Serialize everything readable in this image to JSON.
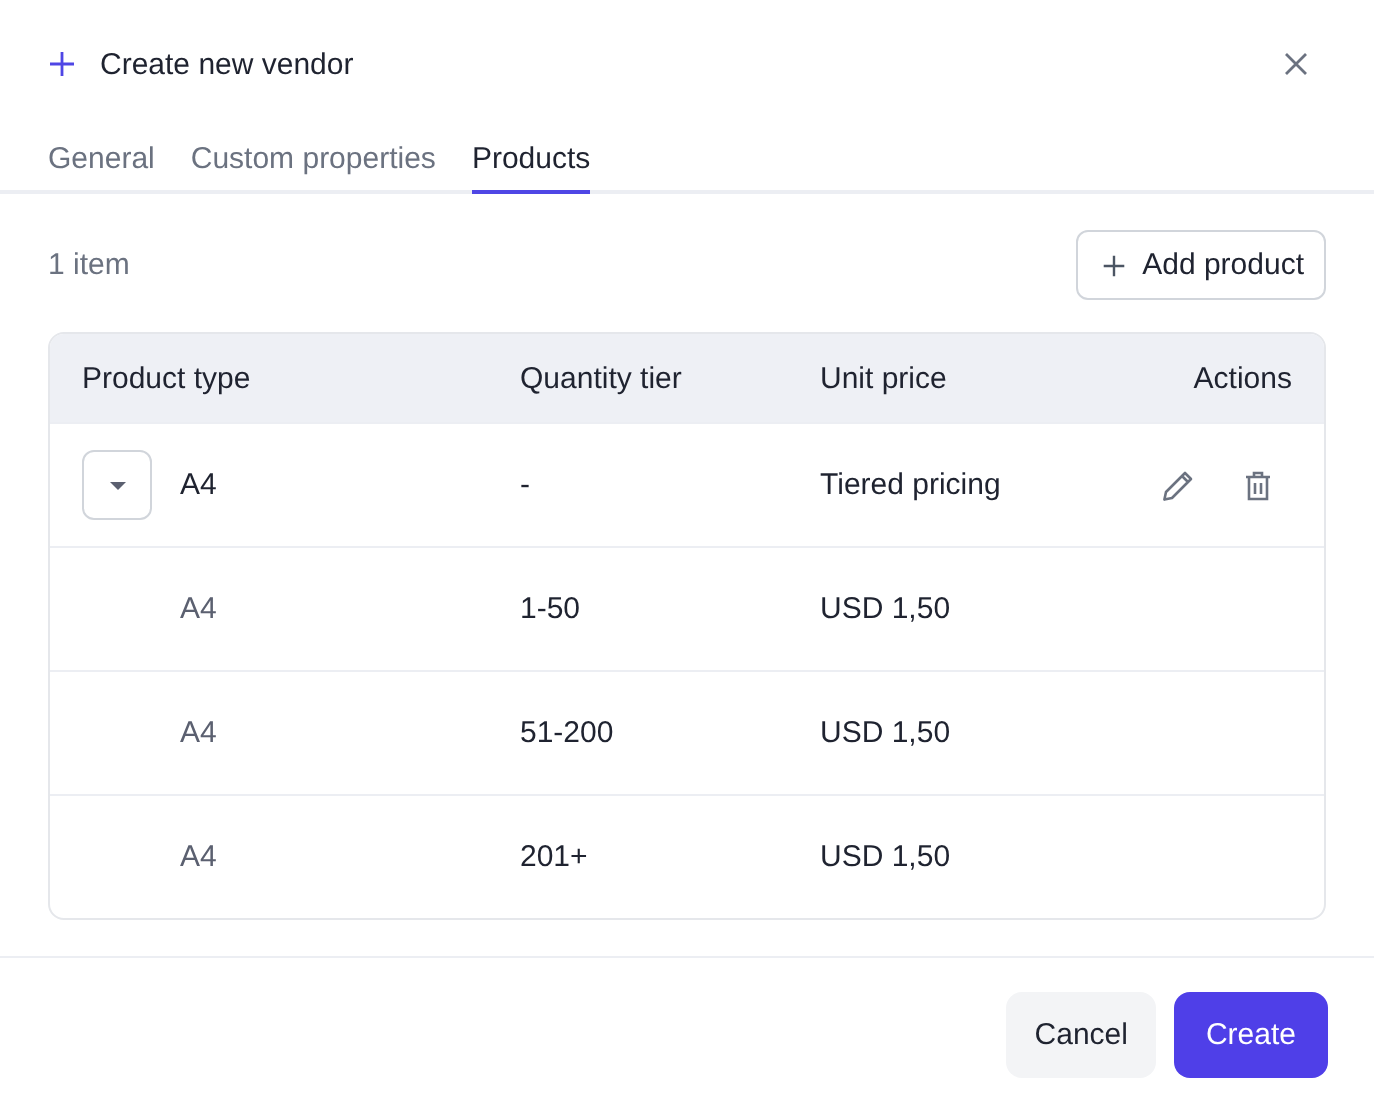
{
  "dialog": {
    "title": "Create new vendor"
  },
  "tabs": [
    {
      "label": "General",
      "selected": false
    },
    {
      "label": "Custom properties",
      "selected": false
    },
    {
      "label": "Products",
      "selected": true
    }
  ],
  "item_count": "1 item",
  "add_button": "Add product",
  "table": {
    "columns": [
      "Product type",
      "Quantity tier",
      "Unit price",
      "Actions"
    ],
    "rows": [
      {
        "product_type": "A4",
        "quantity_tier": "-",
        "unit_price": "Tiered pricing",
        "expanded": true,
        "children": [
          {
            "product_type": "A4",
            "quantity_tier": "1-50",
            "unit_price": "USD 1,50"
          },
          {
            "product_type": "A4",
            "quantity_tier": "51-200",
            "unit_price": "USD 1,50"
          },
          {
            "product_type": "A4",
            "quantity_tier": "201+",
            "unit_price": "USD 1,50"
          }
        ]
      }
    ]
  },
  "footer_buttons": [
    {
      "label": "Cancel",
      "kind": "secondary"
    },
    {
      "label": "Create",
      "kind": "primary"
    }
  ]
}
